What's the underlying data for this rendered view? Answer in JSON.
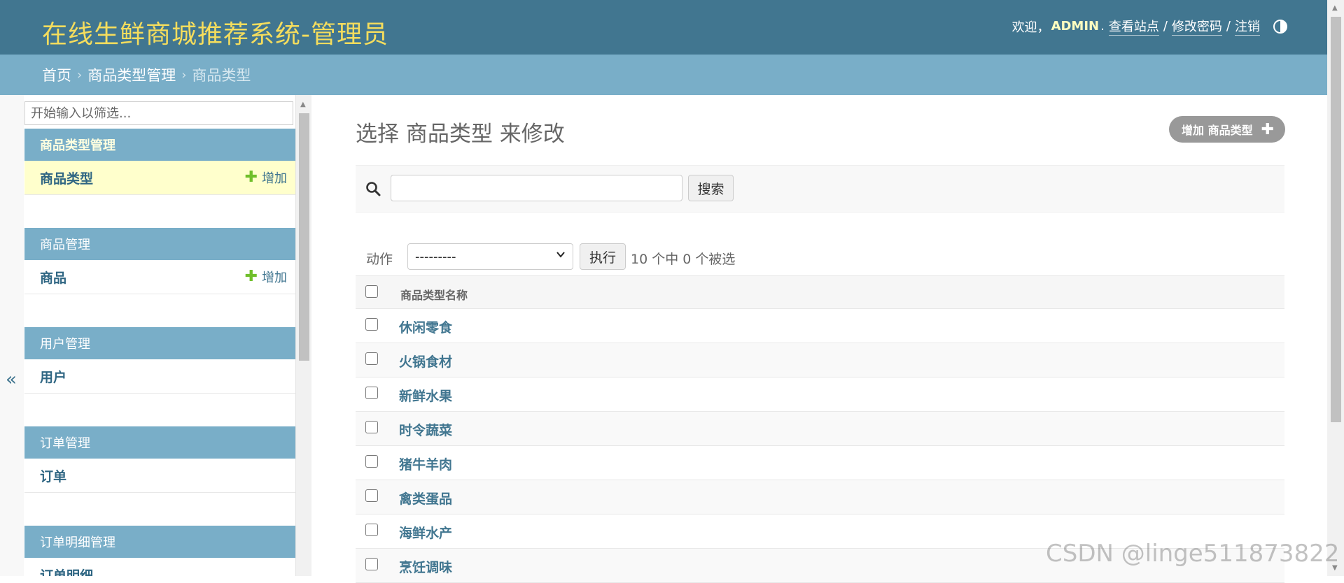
{
  "header": {
    "brand": "在线生鲜商城推荐系统-管理员",
    "welcome": "欢迎，",
    "username": "ADMIN",
    "username_dot": ".",
    "view_site": "查看站点",
    "change_password": "修改密码",
    "logout": "注销",
    "separator": "/",
    "theme_icon": "half-circle-icon"
  },
  "breadcrumbs": {
    "home": "首页",
    "app": "商品类型管理",
    "current": "商品类型",
    "chevron": "›"
  },
  "sidebar": {
    "toggle_symbol": "«",
    "filter_placeholder": "开始输入以筛选...",
    "add_label": "增加",
    "modules": [
      {
        "caption": "商品类型管理",
        "items": [
          {
            "label": "商品类型",
            "has_add": true
          }
        ]
      },
      {
        "caption": "商品管理",
        "items": [
          {
            "label": "商品",
            "has_add": true
          }
        ]
      },
      {
        "caption": "用户管理",
        "items": [
          {
            "label": "用户",
            "has_add": false
          }
        ]
      },
      {
        "caption": "订单管理",
        "items": [
          {
            "label": "订单",
            "has_add": false
          }
        ]
      },
      {
        "caption": "订单明细管理",
        "items": [
          {
            "label": "订单明细",
            "has_add": false
          }
        ]
      }
    ]
  },
  "main": {
    "title": "选择 商品类型 来修改",
    "add_button": "增加 商品类型",
    "search_button": "搜索",
    "action_label": "动作",
    "action_selected": "---------",
    "go_button": "执行",
    "counter": "10 个中 0 个被选",
    "column_header": "商品类型名称",
    "rows": [
      "休闲零食",
      "火锅食材",
      "新鲜水果",
      "时令蔬菜",
      "猪牛羊肉",
      "禽类蛋品",
      "海鲜水产",
      "烹饪调味"
    ]
  },
  "watermark": "CSDN @linge511873822",
  "colors": {
    "header_bg": "#417690",
    "brand": "#f5dd5d",
    "breadcrumb_bg": "#79aec8",
    "link": "#417690",
    "current_row": "#ffffcc",
    "add_green": "#70bf2b"
  }
}
